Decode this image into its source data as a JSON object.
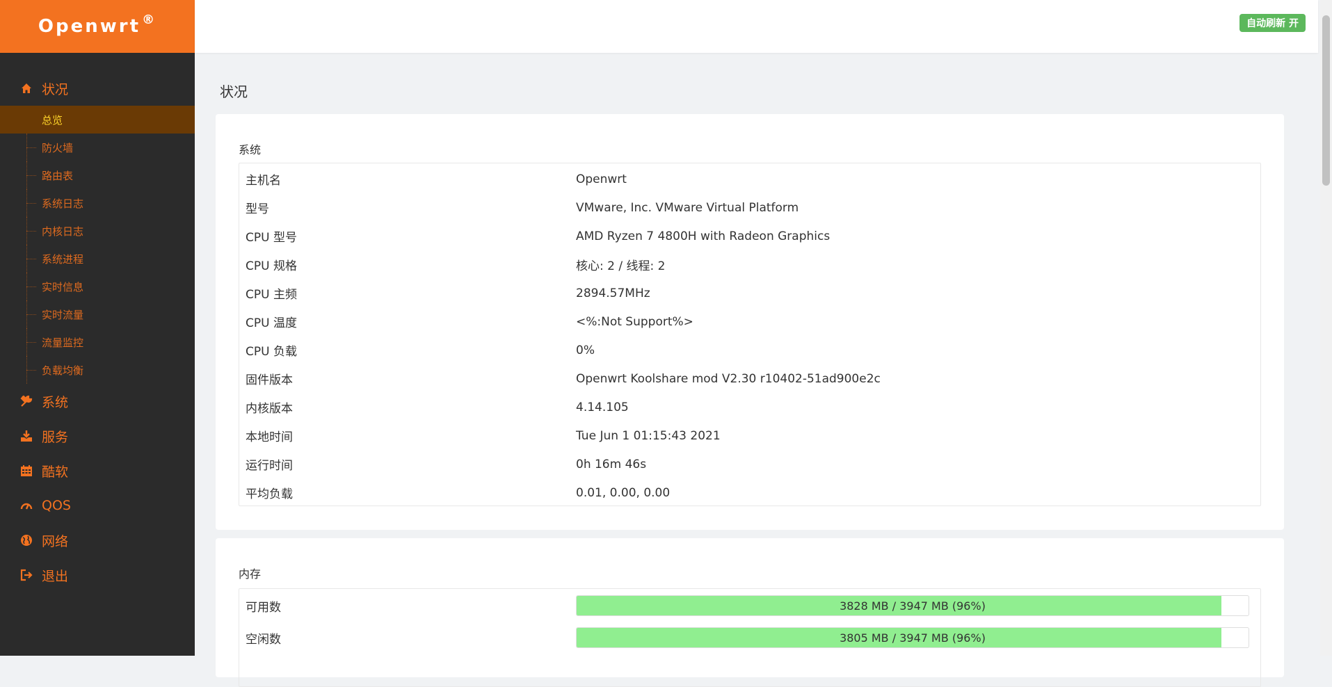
{
  "brand": {
    "name": "Openwrt",
    "mark": "®"
  },
  "header": {
    "auto_refresh": "自动刷新 开"
  },
  "sidebar": {
    "status": {
      "label": "状况",
      "icon": "home-icon"
    },
    "sub_items": [
      {
        "label": "总览",
        "active": true
      },
      {
        "label": "防火墙"
      },
      {
        "label": "路由表"
      },
      {
        "label": "系统日志"
      },
      {
        "label": "内核日志"
      },
      {
        "label": "系统进程"
      },
      {
        "label": "实时信息"
      },
      {
        "label": "实时流量"
      },
      {
        "label": "流量监控"
      },
      {
        "label": "负载均衡"
      }
    ],
    "top_items": [
      {
        "label": "系统",
        "icon": "tools-icon"
      },
      {
        "label": "服务",
        "icon": "download-icon"
      },
      {
        "label": "酷软",
        "icon": "calendar-icon"
      },
      {
        "label": "QOS",
        "icon": "gauge-icon"
      },
      {
        "label": "网络",
        "icon": "globe-icon"
      },
      {
        "label": "退出",
        "icon": "logout-icon"
      }
    ]
  },
  "main": {
    "title": "状况",
    "system": {
      "title": "系统",
      "rows": [
        {
          "label": "主机名",
          "value": "Openwrt"
        },
        {
          "label": "型号",
          "value": "VMware, Inc. VMware Virtual Platform"
        },
        {
          "label": "CPU 型号",
          "value": "AMD Ryzen 7 4800H with Radeon Graphics"
        },
        {
          "label": "CPU 规格",
          "value": "核心: 2 / 线程: 2"
        },
        {
          "label": "CPU 主频",
          "value": "2894.57MHz"
        },
        {
          "label": "CPU 温度",
          "value": "<%:Not Support%>"
        },
        {
          "label": "CPU 负载",
          "value": "0%"
        },
        {
          "label": "固件版本",
          "value": "Openwrt Koolshare mod V2.30 r10402-51ad900e2c"
        },
        {
          "label": "内核版本",
          "value": "4.14.105"
        },
        {
          "label": "本地时间",
          "value": "Tue Jun 1 01:15:43 2021"
        },
        {
          "label": "运行时间",
          "value": "0h 16m 46s"
        },
        {
          "label": "平均负载",
          "value": "0.01, 0.00, 0.00"
        }
      ]
    },
    "memory": {
      "title": "内存",
      "rows": [
        {
          "label": "可用数",
          "text": "3828 MB / 3947 MB (96%)",
          "percent": 96
        },
        {
          "label": "空闲数",
          "text": "3805 MB / 3947 MB (96%)",
          "percent": 96
        }
      ]
    }
  },
  "colors": {
    "accent": "#f37220",
    "sidebar_bg": "#2b2b2b",
    "active_bg": "#6a3a05",
    "active_text": "#ffd42a",
    "bar_fill": "#90ee90",
    "badge": "#5cb85c"
  }
}
